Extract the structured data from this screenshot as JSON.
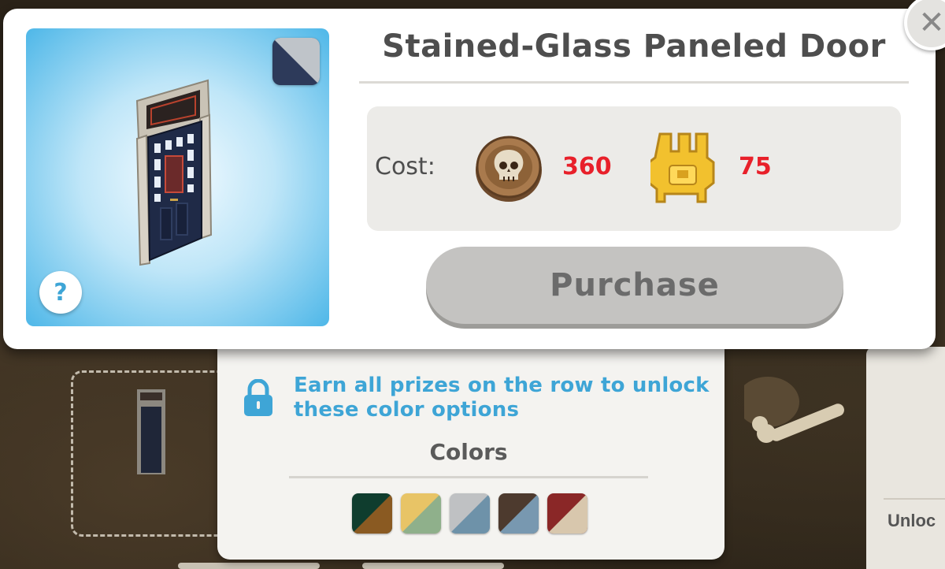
{
  "item": {
    "title": "Stained-Glass Paneled Door",
    "current_color": {
      "primary": "#2d3a5a",
      "secondary": "#bfc4c9"
    },
    "preview_icon": "stained-glass-door"
  },
  "cost": {
    "label": "Cost:",
    "items": [
      {
        "currency": "skull-coin",
        "amount": "360"
      },
      {
        "currency": "golden-trophy",
        "amount": "75"
      }
    ]
  },
  "purchase": {
    "label": "Purchase",
    "enabled": false
  },
  "help": {
    "label": "?"
  },
  "close": {
    "label": "✕"
  },
  "colors": {
    "lock_message": "Earn all prizes on the row to unlock these color options",
    "title": "Colors",
    "options": [
      {
        "primary": "#0f3d2e",
        "secondary": "#8a5a22"
      },
      {
        "primary": "#e8c466",
        "secondary": "#8fb08b"
      },
      {
        "primary": "#bfc1c3",
        "secondary": "#6e92a9"
      },
      {
        "primary": "#4d3a2e",
        "secondary": "#7898b0"
      },
      {
        "primary": "#8a2727",
        "secondary": "#d8c7ad"
      }
    ]
  },
  "background": {
    "side_label": "Unloc"
  }
}
